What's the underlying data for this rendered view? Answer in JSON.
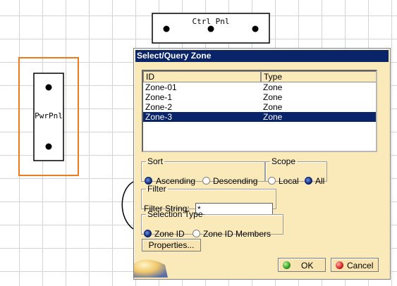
{
  "canvas": {
    "ctrl_panel_label": "Ctrl Pnl",
    "pwr_panel_label": "PwrPnl",
    "accent_color": "#ee7a1c"
  },
  "dialog": {
    "title": "Select/Query Zone",
    "list": {
      "columns": [
        "ID",
        "Type"
      ],
      "rows": [
        {
          "id": "Zone-01",
          "type": "Zone"
        },
        {
          "id": "Zone-1",
          "type": "Zone"
        },
        {
          "id": "Zone-2",
          "type": "Zone"
        },
        {
          "id": "Zone-3",
          "type": "Zone"
        }
      ],
      "selected_row": "Zone-3"
    },
    "sort": {
      "label": "Sort",
      "options": [
        "Ascending",
        "Descending"
      ],
      "selected": "Ascending"
    },
    "scope": {
      "label": "Scope",
      "options": [
        "Local",
        "All"
      ],
      "selected": "All"
    },
    "filter": {
      "label": "Filter",
      "field_label": "Filter String:",
      "value": "*"
    },
    "selection_type": {
      "label": "Selection Type",
      "options": [
        "Zone ID",
        "Zone ID Members"
      ],
      "selected": "Zone ID"
    },
    "properties_button": "Properties...",
    "ok_button": "OK",
    "cancel_button": "Cancel",
    "colors": {
      "dialog_bg": "#fbeab9",
      "title_bg": "#0a246a",
      "selection_bg": "#0a246a",
      "ok_icon": "#2f9a1f",
      "cancel_icon": "#d42020"
    }
  }
}
